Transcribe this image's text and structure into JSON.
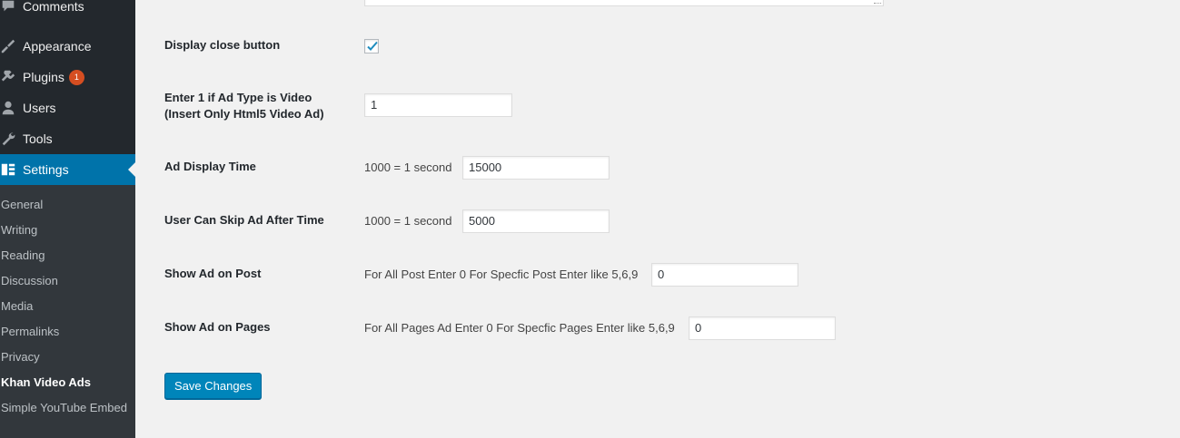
{
  "sidebar": {
    "menu": [
      {
        "label": "Comments",
        "icon": "comments-icon"
      },
      {
        "label": "Appearance",
        "icon": "appearance-icon"
      },
      {
        "label": "Plugins",
        "icon": "plugins-icon",
        "badge": "1"
      },
      {
        "label": "Users",
        "icon": "users-icon"
      },
      {
        "label": "Tools",
        "icon": "tools-icon"
      },
      {
        "label": "Settings",
        "icon": "settings-icon",
        "active": true
      }
    ],
    "submenu": [
      {
        "label": "General"
      },
      {
        "label": "Writing"
      },
      {
        "label": "Reading"
      },
      {
        "label": "Discussion"
      },
      {
        "label": "Media"
      },
      {
        "label": "Permalinks"
      },
      {
        "label": "Privacy"
      },
      {
        "label": "Khan Video Ads",
        "current": true
      },
      {
        "label": "Simple YouTube Embed"
      }
    ]
  },
  "form": {
    "close_button": {
      "label": "Display close button",
      "checked": true
    },
    "video_type": {
      "label_line1": "Enter 1 if Ad Type is Video",
      "label_line2": "(Insert Only Html5 Video Ad)",
      "value": "1"
    },
    "display_time": {
      "label": "Ad Display Time",
      "desc": "1000 = 1 second",
      "value": "15000"
    },
    "skip_time": {
      "label": "User Can Skip Ad After Time",
      "desc": "1000 = 1 second",
      "value": "5000"
    },
    "show_post": {
      "label": "Show Ad on Post",
      "desc": "For All Post Enter 0 For Specfic Post Enter like 5,6,9",
      "value": "0"
    },
    "show_pages": {
      "label": "Show Ad on Pages",
      "desc": "For All Pages Ad Enter 0 For Specfic Pages Enter like 5,6,9",
      "value": "0"
    },
    "save_label": "Save Changes"
  },
  "colors": {
    "admin_bar": "#23282d",
    "accent": "#0073aa",
    "button": "#0085ba",
    "badge": "#d54e21"
  }
}
